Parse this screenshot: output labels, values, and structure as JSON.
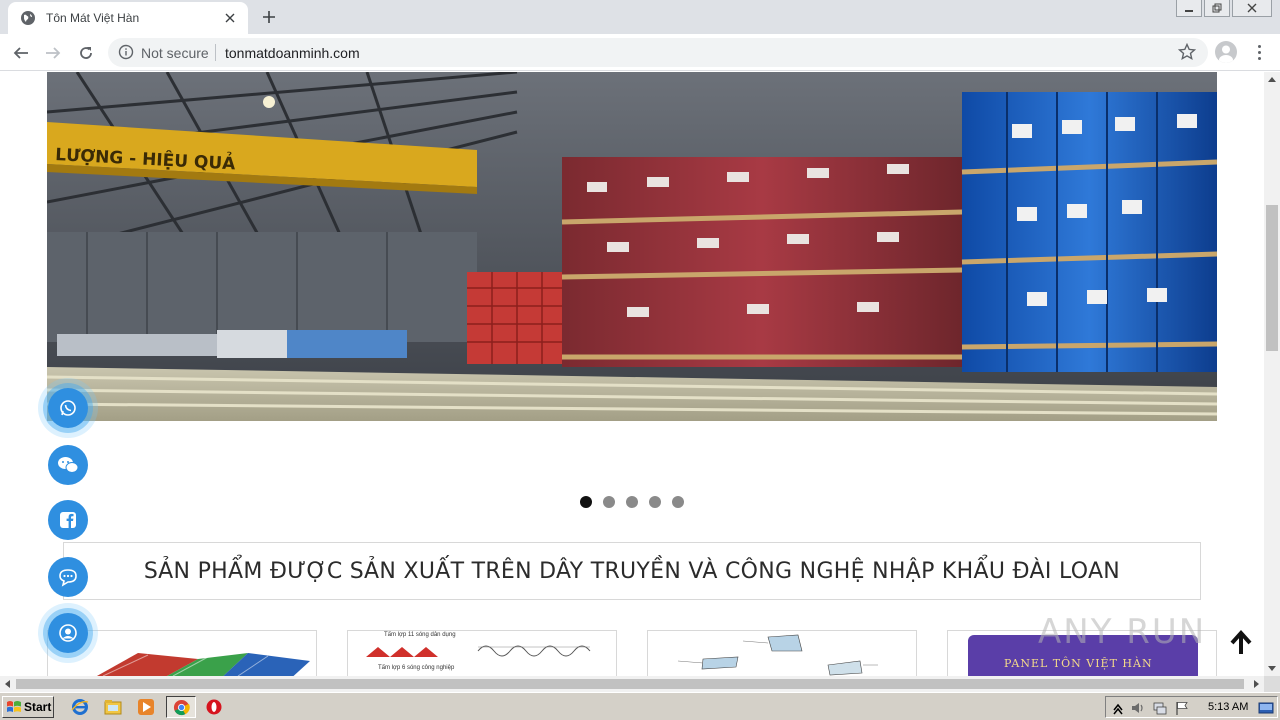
{
  "browser": {
    "tab_title": "Tôn Mát Việt Hàn",
    "security_label": "Not secure",
    "url": "tonmatdoanminh.com"
  },
  "page": {
    "slider_dots": 5,
    "active_dot": 0,
    "section_heading": "SẢN PHẨM ĐƯỢC SẢN XUẤT TRÊN DÂY TRUYỀN VÀ CÔNG NGHỆ NHẬP KHẨU ĐÀI LOAN",
    "hero_sign_text": "LƯỢNG - HIỆU QUẢ",
    "product_cards": [
      {
        "label": "corrugated roofing sheets"
      },
      {
        "top_text": "Tấm lợp 11 sóng dân dụng",
        "bottom_text": "Tấm lợp 6 sóng công nghiệp"
      },
      {
        "label": "roof accessories diagram"
      },
      {
        "top_text": "PANEL TÔN VIỆT HÀN"
      }
    ],
    "floating_contacts": [
      "whatsapp",
      "wechat",
      "facebook",
      "chat",
      "support"
    ],
    "watermark": "ANY RUN"
  },
  "taskbar": {
    "start_label": "Start",
    "clock": "5:13 AM"
  },
  "colors": {
    "accent_blue": "#2f8fe0",
    "tab_strip": "#dee1e6"
  }
}
